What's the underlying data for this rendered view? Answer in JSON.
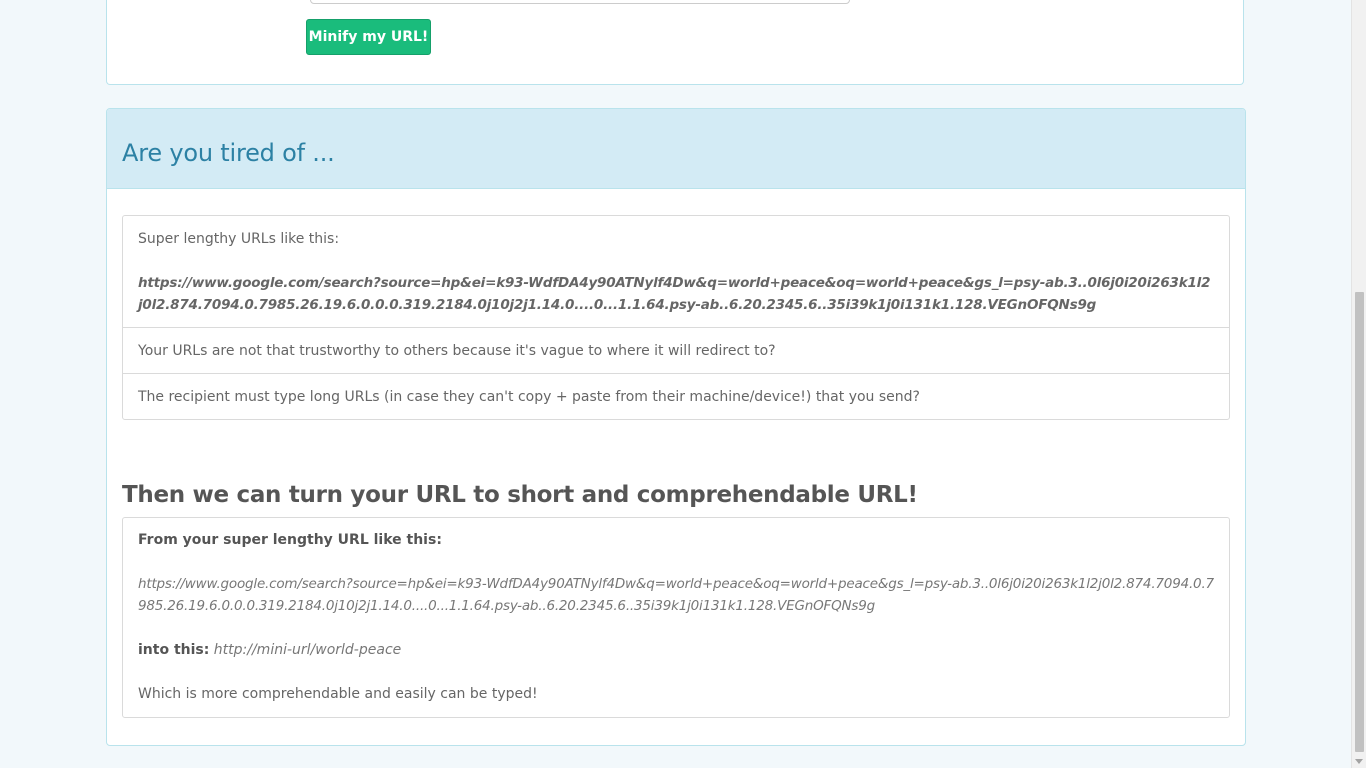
{
  "form": {
    "button_label": "Minify my URL!"
  },
  "panel": {
    "heading": "Are you tired of ...",
    "problems": {
      "item1_text": "Super lengthy URLs like this:",
      "item1_url": "https://www.google.com/search?source=hp&ei=k93-WdfDA4y90ATNylf4Dw&q=world+peace&oq=world+peace&gs_l=psy-ab.3..0l6j0i20i263k1l2j0l2.874.7094.0.7985.26.19.6.0.0.0.319.2184.0j10j2j1.14.0....0...1.1.64.psy-ab..6.20.2345.6..35i39k1j0i131k1.128.VEGnOFQNs9g",
      "item2": "Your URLs are not that trustworthy to others because it's vague to where it will redirect to?",
      "item3": "The recipient must type long URLs (in case they can't copy + paste from their machine/device!) that you send?"
    },
    "solution": {
      "heading": "Then we can turn your URL to short and comprehendable URL!",
      "from_label": "From your super lengthy URL like this:",
      "from_url": "https://www.google.com/search?source=hp&ei=k93-WdfDA4y90ATNylf4Dw&q=world+peace&oq=world+peace&gs_l=psy-ab.3..0l6j0i20i263k1l2j0l2.874.7094.0.7985.26.19.6.0.0.0.319.2184.0j10j2j1.14.0....0...1.1.64.psy-ab..6.20.2345.6..35i39k1j0i131k1.128.VEGnOFQNs9g",
      "into_label": "into this:",
      "into_url": "http://mini-url/world-peace",
      "closing": "Which is more comprehendable and easily can be typed!"
    }
  }
}
